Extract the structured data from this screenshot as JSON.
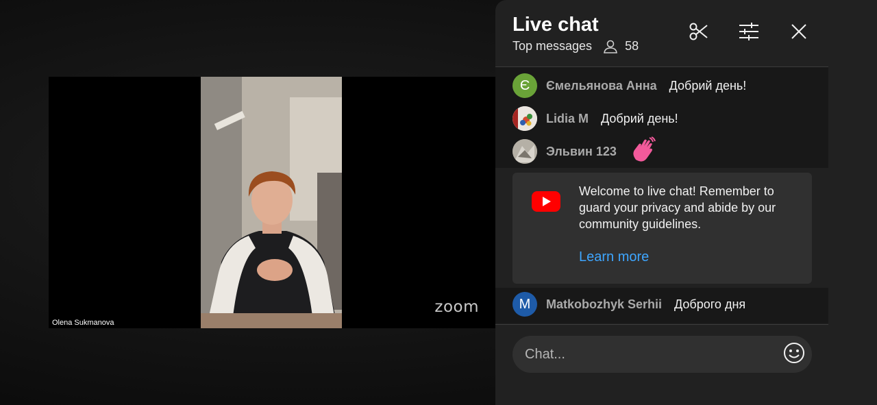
{
  "video": {
    "speaker_name": "Olena Sukmanova",
    "brand": "zoom"
  },
  "chat": {
    "title": "Live chat",
    "mode": "Top messages",
    "viewer_count": "58",
    "header_icons": [
      "clip-icon",
      "filter-sliders-icon",
      "close-icon"
    ],
    "messages": [
      {
        "author": "Ємельянова Анна",
        "text": "Добрий день!",
        "avatar_letter": "Є",
        "avatar_color": "#6aa338"
      },
      {
        "author": "Lidia M",
        "text": "Добрий день!",
        "avatar_letter": "",
        "avatar_color": "#b3302c"
      },
      {
        "author": "Эльвин 123",
        "text": "",
        "emoji": "waving-hand-emoji",
        "avatar_letter": "",
        "avatar_color": "#9e9a92"
      },
      {
        "author": "Matkobozhyk Serhii",
        "text": "Доброго дня",
        "avatar_letter": "M",
        "avatar_color": "#1e5ba8"
      }
    ],
    "welcome": {
      "text": "Welcome to live chat! Remember to guard your privacy and abide by our community guidelines.",
      "link": "Learn more"
    },
    "input": {
      "placeholder": "Chat..."
    }
  },
  "colors": {
    "panel_bg": "#212121",
    "link": "#3ea6ff",
    "youtube_red": "#ff0000"
  }
}
